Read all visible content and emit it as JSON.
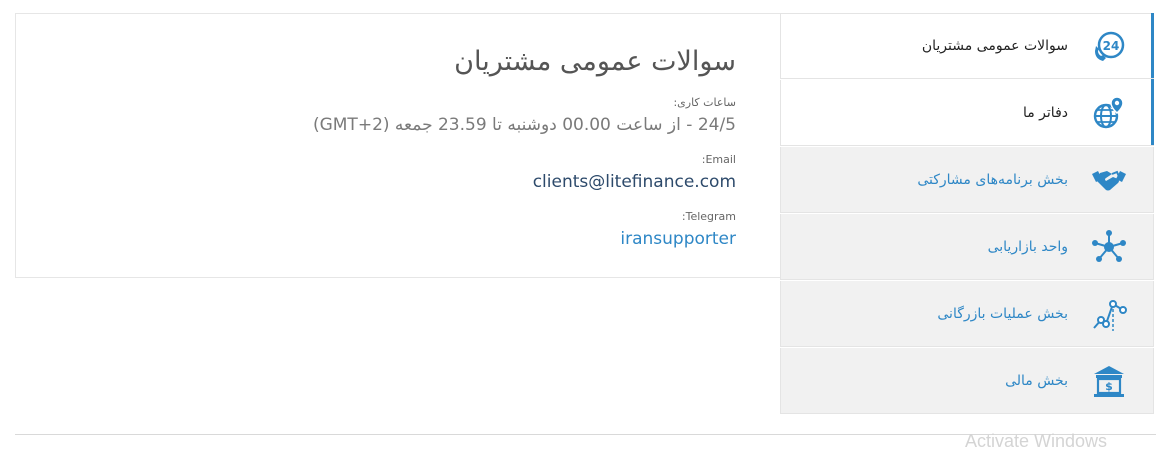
{
  "content": {
    "title": "سوالات عمومی مشتریان",
    "hours_label": "ساعات کاری:",
    "hours_value": "24/5 - از ساعت 00.00 دوشنبه تا 23.59 جمعه (GMT+2)",
    "email_label": "Email:",
    "email_value": "clients@litefinance.com",
    "telegram_label": "Telegram:",
    "telegram_value": "iransupporter"
  },
  "tabs": [
    {
      "label": "سوالات عمومی مشتریان",
      "icon": "support-24-icon",
      "active": true
    },
    {
      "label": "دفاتر ما",
      "icon": "globe-location-icon",
      "active": true
    },
    {
      "label": "بخش برنامه‌های مشارکتی",
      "icon": "handshake-icon",
      "active": false
    },
    {
      "label": "واحد بازاریابی",
      "icon": "network-nodes-icon",
      "active": false
    },
    {
      "label": "بخش عملیات بازرگانی",
      "icon": "chart-line-icon",
      "active": false
    },
    {
      "label": "بخش مالی",
      "icon": "bank-icon",
      "active": false
    }
  ],
  "colors": {
    "accent": "#2e87c6",
    "tab_bg": "#f1f1f1",
    "tab_active_bg": "#ffffff"
  },
  "watermark": "Activate Windows"
}
